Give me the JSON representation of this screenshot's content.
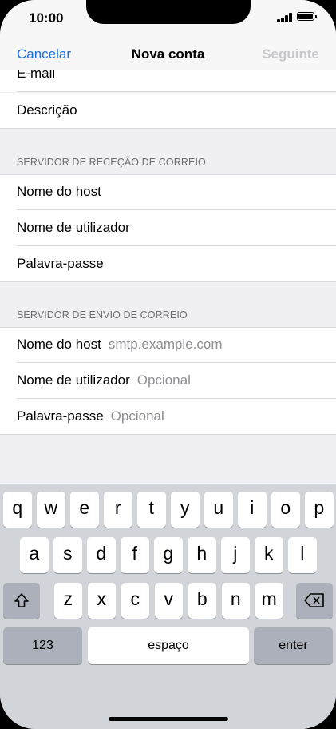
{
  "status_bar": {
    "time": "10:00"
  },
  "nav": {
    "cancel": "Cancelar",
    "title": "Nova conta",
    "next": "Seguinte"
  },
  "form": {
    "partial_field": "E-mail",
    "description_label": "Descrição",
    "incoming_header": "SERVIDOR DE RECEÇÃO DE CORREIO",
    "incoming": {
      "host_label": "Nome do host",
      "user_label": "Nome de utilizador",
      "password_label": "Palavra-passe"
    },
    "outgoing_header": "SERVIDOR DE ENVIO DE CORREIO",
    "outgoing": {
      "host_label": "Nome do host",
      "host_value": "smtp.example.com",
      "user_label": "Nome de utilizador",
      "user_placeholder": "Opcional",
      "password_label": "Palavra-passe",
      "password_placeholder": "Opcional"
    }
  },
  "keyboard": {
    "row1": [
      "q",
      "w",
      "e",
      "r",
      "t",
      "y",
      "u",
      "i",
      "o",
      "p"
    ],
    "row2": [
      "a",
      "s",
      "d",
      "f",
      "g",
      "h",
      "j",
      "k",
      "l"
    ],
    "row3": [
      "z",
      "x",
      "c",
      "v",
      "b",
      "n",
      "m"
    ],
    "numbers_key": "123",
    "space_key": "espaço",
    "enter_key": "enter",
    "shift_icon": "shift-icon",
    "backspace_icon": "backspace-icon"
  },
  "colors": {
    "accent": "#1a6fd8",
    "disabled": "#c7c7cc"
  }
}
